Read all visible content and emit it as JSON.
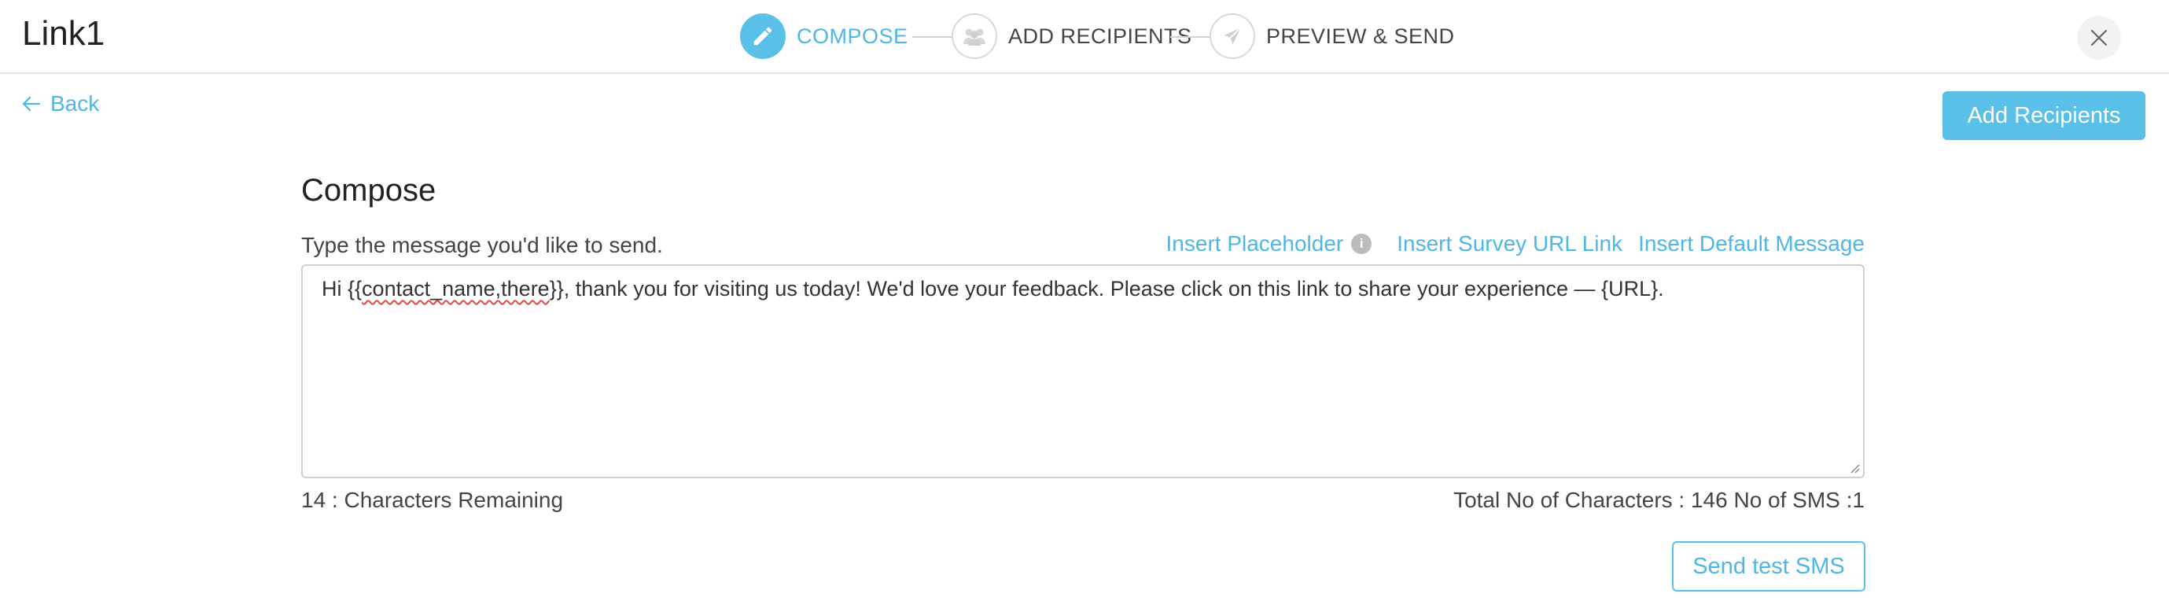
{
  "window": {
    "title": "Link1",
    "close_icon": "close-icon"
  },
  "steps": [
    {
      "label": "COMPOSE",
      "icon": "pencil-icon",
      "state": "active"
    },
    {
      "label": "ADD RECIPIENTS",
      "icon": "group-icon",
      "state": "inactive"
    },
    {
      "label": "PREVIEW & SEND",
      "icon": "paper-plane-icon",
      "state": "inactive"
    }
  ],
  "nav": {
    "back_label": "Back",
    "back_icon": "arrow-left-icon",
    "add_recipients_label": "Add Recipients"
  },
  "compose": {
    "heading": "Compose",
    "instruction": "Type the message you'd like to send.",
    "insert_placeholder": "Insert Placeholder",
    "info_icon": "info-icon",
    "info_glyph": "i",
    "insert_survey_link": "Insert Survey URL Link",
    "insert_default_message": "Insert Default Message",
    "message_prefix": "Hi  {{",
    "message_placeholder": "contact_name,there",
    "message_suffix": "}}, thank you for visiting us today! We'd love your feedback. Please click on this link to share your experience — {URL}.",
    "chars_remaining": "14 : Characters Remaining",
    "total_chars": "Total No of Characters : 146 No of SMS :1",
    "send_test_label": "Send test SMS"
  },
  "colors": {
    "accent": "#5bc0e8",
    "accent_text": "#4eb7e3",
    "text": "#333333",
    "border": "#cfcfcf"
  }
}
